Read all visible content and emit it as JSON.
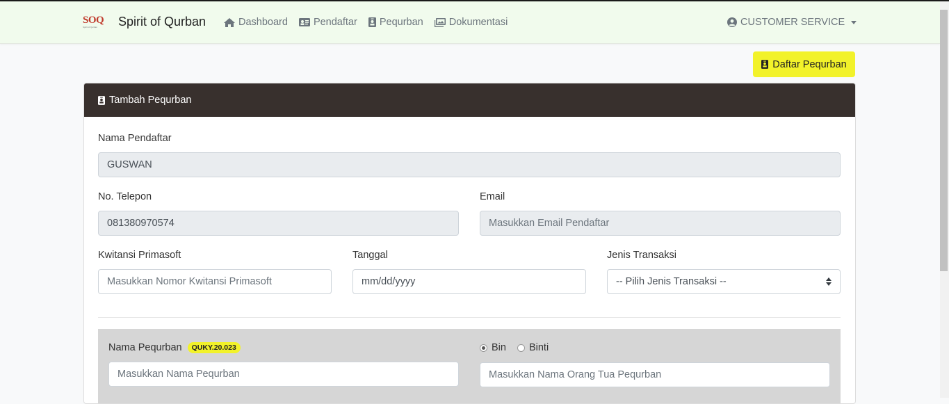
{
  "navbar": {
    "logo_text": "SOQ",
    "logo_sub": "Spirit of Qurban",
    "brand": "Spirit of Qurban",
    "links": [
      {
        "label": "Dashboard",
        "icon": "home-icon"
      },
      {
        "label": "Pendaftar",
        "icon": "id-card-icon"
      },
      {
        "label": "Pequrban",
        "icon": "id-badge-icon"
      },
      {
        "label": "Dokumentasi",
        "icon": "images-icon"
      }
    ],
    "user": "CUSTOMER SERVICE"
  },
  "actions": {
    "daftar_label": "Daftar Pequrban"
  },
  "card": {
    "title": "Tambah Pequrban"
  },
  "form": {
    "nama_pendaftar": {
      "label": "Nama Pendaftar",
      "value": "GUSWAN"
    },
    "telepon": {
      "label": "No. Telepon",
      "value": "081380970574"
    },
    "email": {
      "label": "Email",
      "placeholder": "Masukkan Email Pendaftar"
    },
    "kwitansi": {
      "label": "Kwitansi Primasoft",
      "placeholder": "Masukkan Nomor Kwitansi Primasoft"
    },
    "tanggal": {
      "label": "Tanggal",
      "placeholder": "mm/dd/yyyy"
    },
    "jenis": {
      "label": "Jenis Transaksi",
      "selected": "-- Pilih Jenis Transaksi --"
    }
  },
  "pequrban": {
    "nama_label": "Nama Pequrban",
    "code_badge": "QUKY.20.023",
    "nama_placeholder": "Masukkan Nama Pequrban",
    "radio_bin": "Bin",
    "radio_binti": "Binti",
    "selected_radio": "Bin",
    "ortu_placeholder": "Masukkan Nama Orang Tua Pequrban"
  }
}
